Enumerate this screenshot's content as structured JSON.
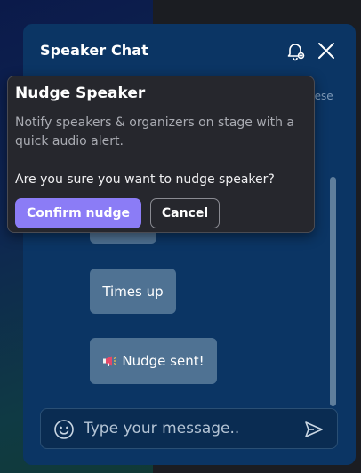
{
  "chat": {
    "title": "Speaker Chat",
    "language_peek": "nese",
    "messages": [
      {
        "text": ""
      },
      {
        "text": "Times up"
      },
      {
        "text": "Nudge sent!",
        "icon": "megaphone-icon"
      }
    ],
    "input": {
      "value": "",
      "placeholder": "Type your message.."
    }
  },
  "popover": {
    "title": "Nudge Speaker",
    "description": "Notify speakers & organizers on stage with a quick audio alert.",
    "question": "Are you sure you want to nudge speaker?",
    "confirm_label": "Confirm nudge",
    "cancel_label": "Cancel"
  },
  "colors": {
    "panel_bg": "#0b3564",
    "bubble_bg": "#4f7293",
    "popover_bg": "#26272d",
    "accent": "#8b7cf6"
  },
  "icons": {
    "bell": "bell-icon",
    "close": "close-icon",
    "emoji": "emoji-icon",
    "send": "send-icon"
  }
}
